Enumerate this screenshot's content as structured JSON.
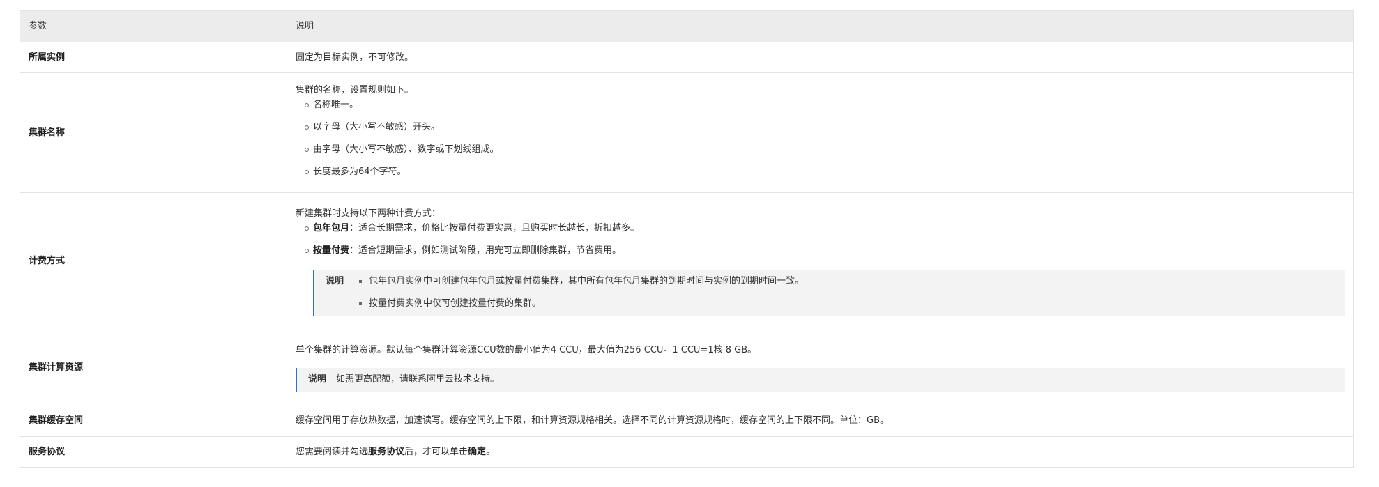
{
  "header": {
    "param": "参数",
    "desc": "说明"
  },
  "rows": {
    "instance": {
      "name": "所属实例",
      "desc": "固定为目标实例，不可修改。"
    },
    "cluster_name": {
      "name": "集群名称",
      "intro": "集群的名称，设置规则如下。",
      "items": [
        "名称唯一。",
        "以字母（大小写不敏感）开头。",
        "由字母（大小写不敏感）、数字或下划线组成。",
        "长度最多为64个字符。"
      ]
    },
    "billing": {
      "name": "计费方式",
      "intro": "新建集群时支持以下两种计费方式：",
      "items": [
        {
          "term": "包年包月",
          "text": "：适合长期需求，价格比按量付费更实惠，且购买时长越长，折扣越多。"
        },
        {
          "term": "按量付费",
          "text": "：适合短期需求，例如测试阶段，用完可立即删除集群，节省费用。"
        }
      ],
      "note_label": "说明",
      "note_items": [
        "包年包月实例中可创建包年包月或按量付费集群，其中所有包年包月集群的到期时间与实例的到期时间一致。",
        "按量付费实例中仅可创建按量付费的集群。"
      ]
    },
    "compute": {
      "name": "集群计算资源",
      "desc": "单个集群的计算资源。默认每个集群计算资源CCU数的最小值为4 CCU，最大值为256 CCU。1 CCU=1核 8 GB。",
      "note_label": "说明",
      "note_text": "如需更高配额，请联系阿里云技术支持。"
    },
    "cache": {
      "name": "集群缓存空间",
      "desc": "缓存空间用于存放热数据，加速读写。缓存空间的上下限，和计算资源规格相关。选择不同的计算资源规格时，缓存空间的上下限不同。单位：GB。"
    },
    "agreement": {
      "name": "服务协议",
      "desc_pre": "您需要阅读并勾选",
      "desc_bold1": "服务协议",
      "desc_mid": "后，才可以单击",
      "desc_bold2": "确定",
      "desc_post": "。"
    }
  },
  "colors": {
    "header_bg": "#ececec",
    "note_bg": "#f3f3f3",
    "note_accent": "#2f6fd6",
    "border": "#e3e3e3"
  }
}
